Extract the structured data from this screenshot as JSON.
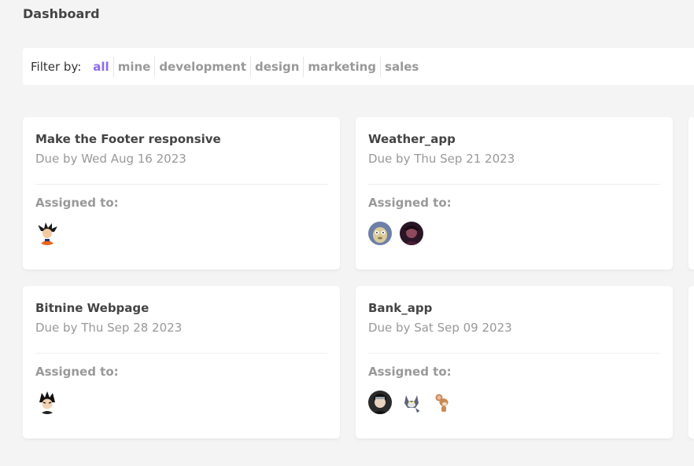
{
  "page": {
    "title": "Dashboard"
  },
  "filter": {
    "label": "Filter by:",
    "items": [
      "all",
      "mine",
      "development",
      "design",
      "marketing",
      "sales"
    ],
    "active": "all"
  },
  "projects": [
    {
      "title": "Make the Footer responsive",
      "due": "Due by Wed Aug 16 2023",
      "assigned_label": "Assigned to:",
      "avatars": [
        "goku-avatar"
      ]
    },
    {
      "title": "Weather_app",
      "due": "Due by Thu Sep 21 2023",
      "assigned_label": "Assigned to:",
      "avatars": [
        "sloth-avatar",
        "dark-portrait-avatar"
      ]
    },
    {
      "title": "Bitnine Webpage",
      "due": "Due by Thu Sep 28 2023",
      "assigned_label": "Assigned to:",
      "avatars": [
        "vegeta-avatar"
      ]
    },
    {
      "title": "Bank_app",
      "due": "Due by Sat Sep 09 2023",
      "assigned_label": "Assigned to:",
      "avatars": [
        "itachi-avatar",
        "tom-cat-avatar",
        "jerry-mouse-avatar"
      ]
    }
  ],
  "colors": {
    "accent": "#8d69f1",
    "background": "#f4f4f4",
    "muted_text": "#999999",
    "heading_text": "#444444"
  }
}
